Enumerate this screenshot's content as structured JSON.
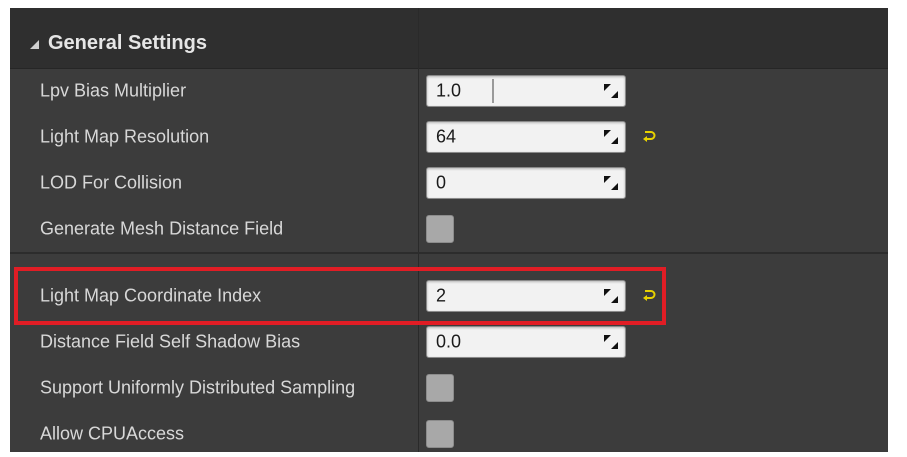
{
  "section": {
    "title": "General Settings",
    "expanded": true,
    "expand_icon": "triangle-down-icon"
  },
  "rows": [
    {
      "label": "Lpv Bias Multiplier",
      "type": "number-slider",
      "value": "1.0",
      "reset": false
    },
    {
      "label": "Light Map Resolution",
      "type": "number",
      "value": "64",
      "reset": true
    },
    {
      "label": "LOD For Collision",
      "type": "number",
      "value": "0",
      "reset": false
    },
    {
      "label": "Generate Mesh Distance Field",
      "type": "checkbox",
      "checked": false
    },
    {
      "label": "Light Map Coordinate Index",
      "type": "number",
      "value": "2",
      "reset": true,
      "highlighted": true
    },
    {
      "label": "Distance Field Self Shadow Bias",
      "type": "number",
      "value": "0.0",
      "reset": false
    },
    {
      "label": "Support Uniformly Distributed Sampling",
      "type": "checkbox",
      "checked": false
    },
    {
      "label": "Allow CPUAccess",
      "type": "checkbox",
      "checked": false
    }
  ],
  "colors": {
    "panel_bg": "#3c3c3c",
    "header_bg": "#2f2f2f",
    "label_text": "#d8d8d8",
    "reset_icon": "#e8d200",
    "highlight_box": "#e11d25"
  },
  "icons": {
    "spin": "drag-arrows-icon",
    "reset": "reset-to-default-icon"
  }
}
